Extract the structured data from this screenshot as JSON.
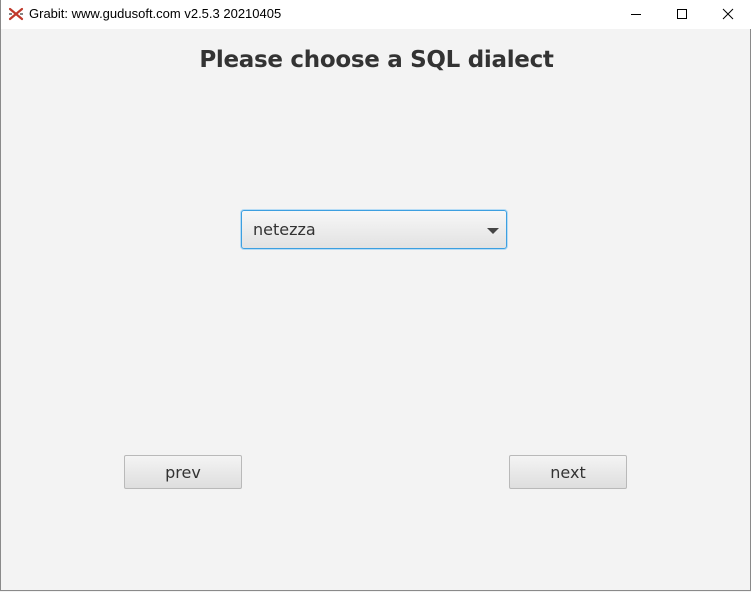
{
  "window": {
    "title": "Grabit: www.gudusoft.com  v2.5.3 20210405",
    "icon": "grabit-x-icon",
    "accent_color": "#c0392b"
  },
  "controls": {
    "minimize_icon": "minimize-icon",
    "maximize_icon": "maximize-icon",
    "close_icon": "close-icon"
  },
  "page": {
    "heading": "Please choose a SQL dialect"
  },
  "dialect_select": {
    "selected_value": "netezza",
    "icon": "chevron-down-icon",
    "focus_color": "#3c9fe0"
  },
  "navigation": {
    "prev_label": "prev",
    "next_label": "next"
  }
}
